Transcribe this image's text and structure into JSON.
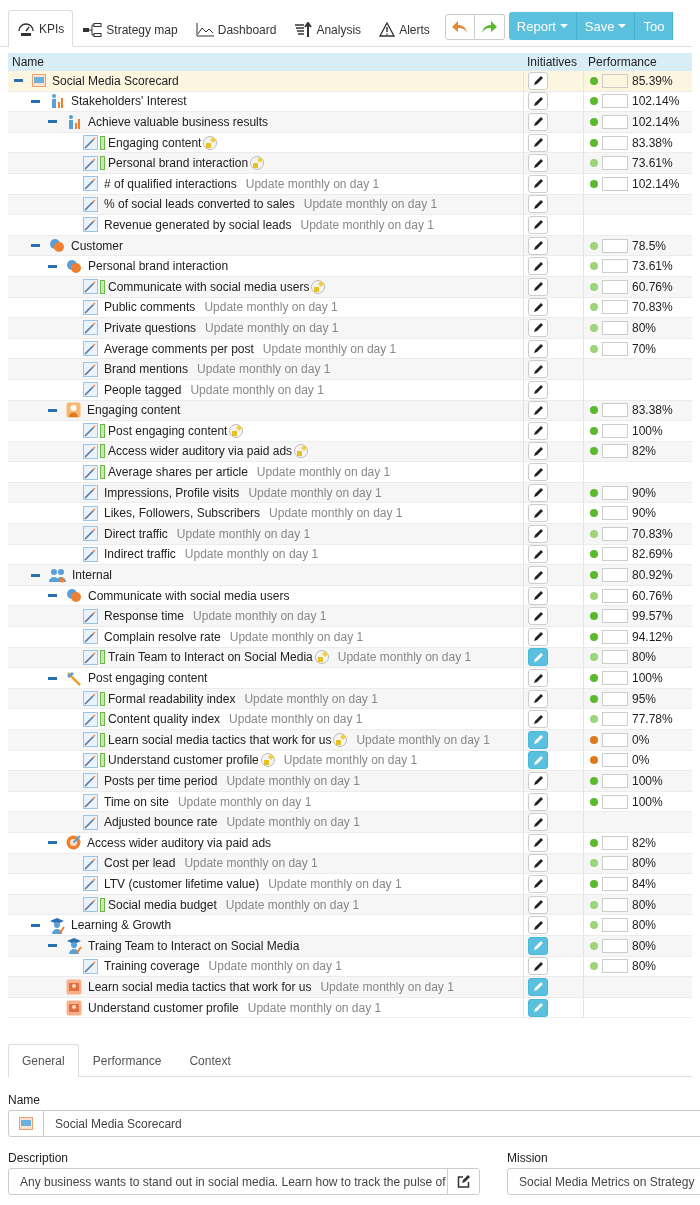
{
  "toolbar": {
    "tabs": [
      {
        "label": "KPIs",
        "selected": true
      },
      {
        "label": "Strategy map",
        "selected": false
      },
      {
        "label": "Dashboard",
        "selected": false
      },
      {
        "label": "Analysis",
        "selected": false
      },
      {
        "label": "Alerts",
        "selected": false
      }
    ],
    "actions": [
      {
        "label": "Report",
        "dropdown": true
      },
      {
        "label": "Save",
        "dropdown": true
      },
      {
        "label": "Too",
        "dropdown": false
      }
    ]
  },
  "table": {
    "columns": [
      "Name",
      "Initiatives",
      "Performance"
    ],
    "tree": [
      {
        "name": "Social Media Scorecard",
        "kind": "scorecard",
        "linked": false,
        "alert": false,
        "has_initiatives": false,
        "selected": true,
        "performance": {
          "color": "#5cb82c",
          "value": "85.39%"
        },
        "expanded": true,
        "children": [
          {
            "name": "Stakeholders' Interest",
            "kind": "stakeholder",
            "linked": false,
            "alert": false,
            "has_initiatives": false,
            "selected": false,
            "performance": {
              "color": "#5cb82c",
              "value": "102.14%"
            },
            "expanded": true,
            "children": [
              {
                "name": "Achieve valuable business results",
                "kind": "stakeholder",
                "linked": false,
                "alert": false,
                "has_initiatives": false,
                "selected": false,
                "performance": {
                  "color": "#5cb82c",
                  "value": "102.14%"
                },
                "expanded": true,
                "children": [
                  {
                    "name": "Engaging content",
                    "kind": "kpi",
                    "linked": true,
                    "alert": true,
                    "has_initiatives": false,
                    "selected": false,
                    "performance": {
                      "color": "#5cb82c",
                      "value": "83.38%"
                    }
                  },
                  {
                    "name": "Personal brand interaction",
                    "kind": "kpi",
                    "linked": true,
                    "alert": true,
                    "has_initiatives": false,
                    "selected": false,
                    "performance": {
                      "color": "#9ed47a",
                      "value": "73.61%"
                    }
                  },
                  {
                    "name": "# of qualified interactions",
                    "note": "Update monthly on day 1",
                    "kind": "kpi",
                    "linked": false,
                    "alert": false,
                    "has_initiatives": false,
                    "selected": false,
                    "performance": {
                      "color": "#5cb82c",
                      "value": "102.14%"
                    }
                  },
                  {
                    "name": "% of social leads converted to sales",
                    "note": "Update monthly on day 1",
                    "kind": "kpi",
                    "linked": false,
                    "alert": false,
                    "has_initiatives": false,
                    "selected": false
                  },
                  {
                    "name": "Revenue generated by social leads",
                    "note": "Update monthly on day 1",
                    "kind": "kpi",
                    "linked": false,
                    "alert": false,
                    "has_initiatives": false,
                    "selected": false
                  }
                ]
              }
            ]
          },
          {
            "name": "Customer",
            "kind": "customer",
            "linked": false,
            "alert": false,
            "has_initiatives": false,
            "selected": false,
            "performance": {
              "color": "#9ed47a",
              "value": "78.5%"
            },
            "expanded": true,
            "children": [
              {
                "name": "Personal brand interaction",
                "kind": "customer",
                "linked": false,
                "alert": false,
                "has_initiatives": false,
                "selected": false,
                "performance": {
                  "color": "#9ed47a",
                  "value": "73.61%"
                },
                "expanded": true,
                "children": [
                  {
                    "name": "Communicate with social media users",
                    "kind": "kpi",
                    "linked": true,
                    "alert": true,
                    "has_initiatives": false,
                    "selected": false,
                    "performance": {
                      "color": "#9ed47a",
                      "value": "60.76%"
                    }
                  },
                  {
                    "name": "Public comments",
                    "note": "Update monthly on day 1",
                    "kind": "kpi",
                    "linked": false,
                    "alert": false,
                    "has_initiatives": false,
                    "selected": false,
                    "performance": {
                      "color": "#9ed47a",
                      "value": "70.83%"
                    }
                  },
                  {
                    "name": "Private questions",
                    "note": "Update monthly on day 1",
                    "kind": "kpi",
                    "linked": false,
                    "alert": false,
                    "has_initiatives": false,
                    "selected": false,
                    "performance": {
                      "color": "#9ed47a",
                      "value": "80%"
                    }
                  },
                  {
                    "name": "Average comments per post",
                    "note": "Update monthly on day 1",
                    "kind": "kpi",
                    "linked": false,
                    "alert": false,
                    "has_initiatives": false,
                    "selected": false,
                    "performance": {
                      "color": "#9ed47a",
                      "value": "70%"
                    }
                  },
                  {
                    "name": "Brand mentions",
                    "note": "Update monthly on day 1",
                    "kind": "kpi",
                    "linked": false,
                    "alert": false,
                    "has_initiatives": false,
                    "selected": false
                  },
                  {
                    "name": "People tagged",
                    "note": "Update monthly on day 1",
                    "kind": "kpi",
                    "linked": false,
                    "alert": false,
                    "has_initiatives": false,
                    "selected": false
                  }
                ]
              },
              {
                "name": "Engaging content",
                "kind": "goal",
                "linked": false,
                "alert": false,
                "has_initiatives": false,
                "selected": false,
                "performance": {
                  "color": "#5cb82c",
                  "value": "83.38%"
                },
                "expanded": true,
                "children": [
                  {
                    "name": "Post engaging content",
                    "kind": "kpi",
                    "linked": true,
                    "alert": true,
                    "has_initiatives": false,
                    "selected": false,
                    "performance": {
                      "color": "#5cb82c",
                      "value": "100%"
                    }
                  },
                  {
                    "name": "Access wider auditory via paid ads",
                    "kind": "kpi",
                    "linked": true,
                    "alert": true,
                    "has_initiatives": false,
                    "selected": false,
                    "performance": {
                      "color": "#5cb82c",
                      "value": "82%"
                    }
                  },
                  {
                    "name": "Average shares per article",
                    "note": "Update monthly on day 1",
                    "kind": "kpi",
                    "linked": true,
                    "alert": false,
                    "has_initiatives": false,
                    "selected": false
                  },
                  {
                    "name": "Impressions, Profile visits",
                    "note": "Update monthly on day 1",
                    "kind": "kpi",
                    "linked": false,
                    "alert": false,
                    "has_initiatives": false,
                    "selected": false,
                    "performance": {
                      "color": "#5cb82c",
                      "value": "90%"
                    }
                  },
                  {
                    "name": "Likes, Followers, Subscribers",
                    "note": "Update monthly on day 1",
                    "kind": "kpi",
                    "linked": false,
                    "alert": false,
                    "has_initiatives": false,
                    "selected": false,
                    "performance": {
                      "color": "#5cb82c",
                      "value": "90%"
                    }
                  },
                  {
                    "name": "Direct traffic",
                    "note": "Update monthly on day 1",
                    "kind": "kpi",
                    "linked": false,
                    "alert": false,
                    "has_initiatives": false,
                    "selected": false,
                    "performance": {
                      "color": "#9ed47a",
                      "value": "70.83%"
                    }
                  },
                  {
                    "name": "Indirect traffic",
                    "note": "Update monthly on day 1",
                    "kind": "kpi",
                    "linked": false,
                    "alert": false,
                    "has_initiatives": false,
                    "selected": false,
                    "performance": {
                      "color": "#5cb82c",
                      "value": "82.69%"
                    }
                  }
                ]
              }
            ]
          },
          {
            "name": "Internal",
            "kind": "team",
            "linked": false,
            "alert": false,
            "has_initiatives": false,
            "selected": false,
            "performance": {
              "color": "#5cb82c",
              "value": "80.92%"
            },
            "expanded": true,
            "children": [
              {
                "name": "Communicate with social media users",
                "kind": "customer",
                "linked": false,
                "alert": false,
                "has_initiatives": false,
                "selected": false,
                "performance": {
                  "color": "#9ed47a",
                  "value": "60.76%"
                },
                "expanded": true,
                "children": [
                  {
                    "name": "Response time",
                    "note": "Update monthly on day 1",
                    "kind": "kpi",
                    "linked": false,
                    "alert": false,
                    "has_initiatives": false,
                    "selected": false,
                    "performance": {
                      "color": "#5cb82c",
                      "value": "99.57%"
                    }
                  },
                  {
                    "name": "Complain resolve rate",
                    "note": "Update monthly on day 1",
                    "kind": "kpi",
                    "linked": false,
                    "alert": false,
                    "has_initiatives": false,
                    "selected": false,
                    "performance": {
                      "color": "#5cb82c",
                      "value": "94.12%"
                    }
                  },
                  {
                    "name": "Train Team to Interact on Social Media",
                    "note": "Update monthly on day 1",
                    "kind": "kpi",
                    "linked": true,
                    "alert": true,
                    "has_initiatives": true,
                    "selected": false,
                    "performance": {
                      "color": "#9ed47a",
                      "value": "80%"
                    }
                  }
                ]
              },
              {
                "name": "Post engaging content",
                "kind": "tools",
                "linked": false,
                "alert": false,
                "has_initiatives": false,
                "selected": false,
                "performance": {
                  "color": "#5cb82c",
                  "value": "100%"
                },
                "expanded": true,
                "children": [
                  {
                    "name": "Formal readability index",
                    "note": "Update monthly on day 1",
                    "kind": "kpi",
                    "linked": true,
                    "alert": false,
                    "has_initiatives": false,
                    "selected": false,
                    "performance": {
                      "color": "#5cb82c",
                      "value": "95%"
                    }
                  },
                  {
                    "name": "Content quality index",
                    "note": "Update monthly on day 1",
                    "kind": "kpi",
                    "linked": true,
                    "alert": false,
                    "has_initiatives": false,
                    "selected": false,
                    "performance": {
                      "color": "#9ed47a",
                      "value": "77.78%"
                    }
                  },
                  {
                    "name": "Learn social media tactics that work for us",
                    "note": "Update monthly on day 1",
                    "kind": "kpi",
                    "linked": true,
                    "alert": true,
                    "has_initiatives": true,
                    "selected": false,
                    "performance": {
                      "color": "#e07820",
                      "value": "0%"
                    }
                  },
                  {
                    "name": "Understand customer profile",
                    "note": "Update monthly on day 1",
                    "kind": "kpi",
                    "linked": true,
                    "alert": true,
                    "has_initiatives": true,
                    "selected": false,
                    "performance": {
                      "color": "#e07820",
                      "value": "0%"
                    }
                  },
                  {
                    "name": "Posts per time period",
                    "note": "Update monthly on day 1",
                    "kind": "kpi",
                    "linked": false,
                    "alert": false,
                    "has_initiatives": false,
                    "selected": false,
                    "performance": {
                      "color": "#5cb82c",
                      "value": "100%"
                    }
                  },
                  {
                    "name": "Time on site",
                    "note": "Update monthly on day 1",
                    "kind": "kpi",
                    "linked": false,
                    "alert": false,
                    "has_initiatives": false,
                    "selected": false,
                    "performance": {
                      "color": "#5cb82c",
                      "value": "100%"
                    }
                  },
                  {
                    "name": "Adjusted bounce rate",
                    "note": "Update monthly on day 1",
                    "kind": "kpi",
                    "linked": false,
                    "alert": false,
                    "has_initiatives": false,
                    "selected": false
                  }
                ]
              },
              {
                "name": "Access wider auditory via paid ads",
                "kind": "target",
                "linked": false,
                "alert": false,
                "has_initiatives": false,
                "selected": false,
                "performance": {
                  "color": "#5cb82c",
                  "value": "82%"
                },
                "expanded": true,
                "children": [
                  {
                    "name": "Cost per lead",
                    "note": "Update monthly on day 1",
                    "kind": "kpi",
                    "linked": false,
                    "alert": false,
                    "has_initiatives": false,
                    "selected": false,
                    "performance": {
                      "color": "#9ed47a",
                      "value": "80%"
                    }
                  },
                  {
                    "name": "LTV (customer lifetime value)",
                    "note": "Update monthly on day 1",
                    "kind": "kpi",
                    "linked": false,
                    "alert": false,
                    "has_initiatives": false,
                    "selected": false,
                    "performance": {
                      "color": "#5cb82c",
                      "value": "84%"
                    }
                  },
                  {
                    "name": "Social media budget",
                    "note": "Update monthly on day 1",
                    "kind": "kpi",
                    "linked": true,
                    "alert": false,
                    "has_initiatives": false,
                    "selected": false,
                    "performance": {
                      "color": "#9ed47a",
                      "value": "80%"
                    }
                  }
                ]
              }
            ]
          },
          {
            "name": "Learning & Growth",
            "kind": "growth",
            "linked": false,
            "alert": false,
            "has_initiatives": false,
            "selected": false,
            "performance": {
              "color": "#9ed47a",
              "value": "80%"
            },
            "expanded": true,
            "children": [
              {
                "name": "Traing Team to Interact on Social Media",
                "kind": "growth",
                "linked": false,
                "alert": false,
                "has_initiatives": true,
                "selected": false,
                "performance": {
                  "color": "#9ed47a",
                  "value": "80%"
                },
                "expanded": true,
                "children": [
                  {
                    "name": "Training coverage",
                    "note": "Update monthly on day 1",
                    "kind": "kpi",
                    "linked": false,
                    "alert": false,
                    "has_initiatives": false,
                    "selected": false,
                    "performance": {
                      "color": "#9ed47a",
                      "value": "80%"
                    }
                  }
                ]
              },
              {
                "name": "Learn social media tactics that work for us",
                "note": "Update monthly on day 1",
                "kind": "initiative",
                "linked": false,
                "alert": false,
                "has_initiatives": true,
                "selected": false
              },
              {
                "name": "Understand customer profile",
                "note": "Update monthly on day 1",
                "kind": "initiative",
                "linked": false,
                "alert": false,
                "has_initiatives": true,
                "selected": false
              }
            ]
          }
        ]
      }
    ]
  },
  "details": {
    "tabs": [
      {
        "label": "General",
        "selected": true
      },
      {
        "label": "Performance",
        "selected": false
      },
      {
        "label": "Context",
        "selected": false
      }
    ],
    "name": {
      "label": "Name",
      "value": "Social Media Scorecard"
    },
    "description": {
      "label": "Description",
      "value": "Any business wants to stand out in social media. Learn how to track the pulse of"
    },
    "mission": {
      "label": "Mission",
      "value": "Social Media Metrics on Strategy"
    }
  }
}
